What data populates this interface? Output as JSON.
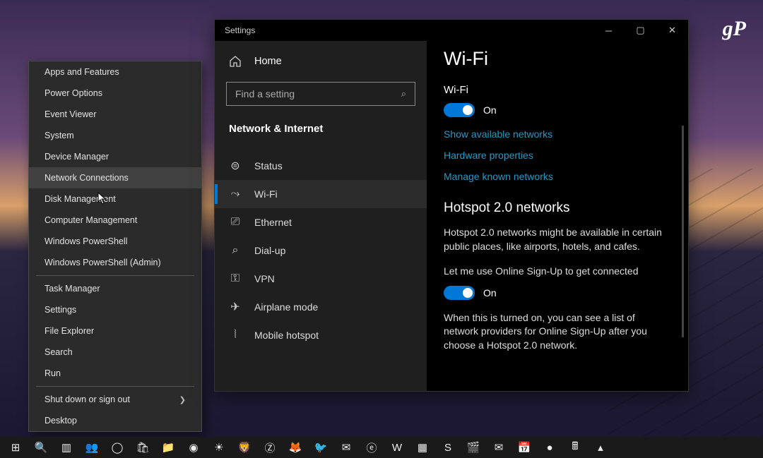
{
  "watermark": "gP",
  "winx": {
    "items": [
      {
        "label": "Apps and Features",
        "chevron": false
      },
      {
        "label": "Power Options",
        "chevron": false
      },
      {
        "label": "Event Viewer",
        "chevron": false
      },
      {
        "label": "System",
        "chevron": false
      },
      {
        "label": "Device Manager",
        "chevron": false
      },
      {
        "label": "Network Connections",
        "chevron": false,
        "hover": true
      },
      {
        "label": "Disk Management",
        "chevron": false
      },
      {
        "label": "Computer Management",
        "chevron": false
      },
      {
        "label": "Windows PowerShell",
        "chevron": false
      },
      {
        "label": "Windows PowerShell (Admin)",
        "chevron": false
      },
      {
        "sep": true
      },
      {
        "label": "Task Manager",
        "chevron": false
      },
      {
        "label": "Settings",
        "chevron": false
      },
      {
        "label": "File Explorer",
        "chevron": false
      },
      {
        "label": "Search",
        "chevron": false
      },
      {
        "label": "Run",
        "chevron": false
      },
      {
        "sep": true
      },
      {
        "label": "Shut down or sign out",
        "chevron": true
      },
      {
        "label": "Desktop",
        "chevron": false
      }
    ]
  },
  "settings": {
    "title": "Settings",
    "home_label": "Home",
    "search_placeholder": "Find a setting",
    "section_header": "Network & Internet",
    "nav_items": [
      {
        "icon": "status-icon",
        "glyph": "⊜",
        "label": "Status",
        "selected": false
      },
      {
        "icon": "wifi-icon",
        "glyph": "⤳",
        "label": "Wi-Fi",
        "selected": true
      },
      {
        "icon": "ethernet-icon",
        "glyph": "⎚",
        "label": "Ethernet",
        "selected": false
      },
      {
        "icon": "dialup-icon",
        "glyph": "⌕",
        "label": "Dial-up",
        "selected": false
      },
      {
        "icon": "vpn-icon",
        "glyph": "⚿",
        "label": "VPN",
        "selected": false
      },
      {
        "icon": "airplane-icon",
        "glyph": "✈",
        "label": "Airplane mode",
        "selected": false
      },
      {
        "icon": "hotspot-icon",
        "glyph": "⦚",
        "label": "Mobile hotspot",
        "selected": false
      }
    ]
  },
  "wifi": {
    "page_title": "Wi-Fi",
    "toggle1_label": "Wi-Fi",
    "toggle1_state": "On",
    "link_available": "Show available networks",
    "link_hw": "Hardware properties",
    "link_known": "Manage known networks",
    "hotspot_header": "Hotspot 2.0 networks",
    "hotspot_para1": "Hotspot 2.0 networks might be available in certain public places, like airports, hotels, and cafes.",
    "hotspot_toggle_caption": "Let me use Online Sign-Up to get connected",
    "hotspot_toggle_state": "On",
    "hotspot_para2": "When this is turned on, you can see a list of network providers for Online Sign-Up after you choose a Hotspot 2.0 network."
  },
  "taskbar": {
    "icons": [
      "start-icon",
      "search-icon",
      "taskview-icon",
      "people-icon",
      "cortana-icon",
      "store-icon",
      "explorer-icon",
      "chrome-icon",
      "flux-icon",
      "brave-icon",
      "zoho-icon",
      "firefox-icon",
      "app1-icon",
      "mail-icon",
      "edge-icon",
      "word-icon",
      "app2-icon",
      "sway-icon",
      "movies-icon",
      "mail2-icon",
      "calendar-icon",
      "app3-icon",
      "calc-icon",
      "vlc-icon"
    ],
    "glyphs": [
      "⊞",
      "🔍",
      "▥",
      "👥",
      "◯",
      "🛍",
      "📁",
      "◉",
      "☀",
      "🦁",
      "Ⓩ",
      "🦊",
      "🐦",
      "✉",
      "ⓔ",
      "W",
      "▦",
      "S",
      "🎬",
      "✉",
      "📅",
      "●",
      "🖩",
      "▴"
    ]
  }
}
